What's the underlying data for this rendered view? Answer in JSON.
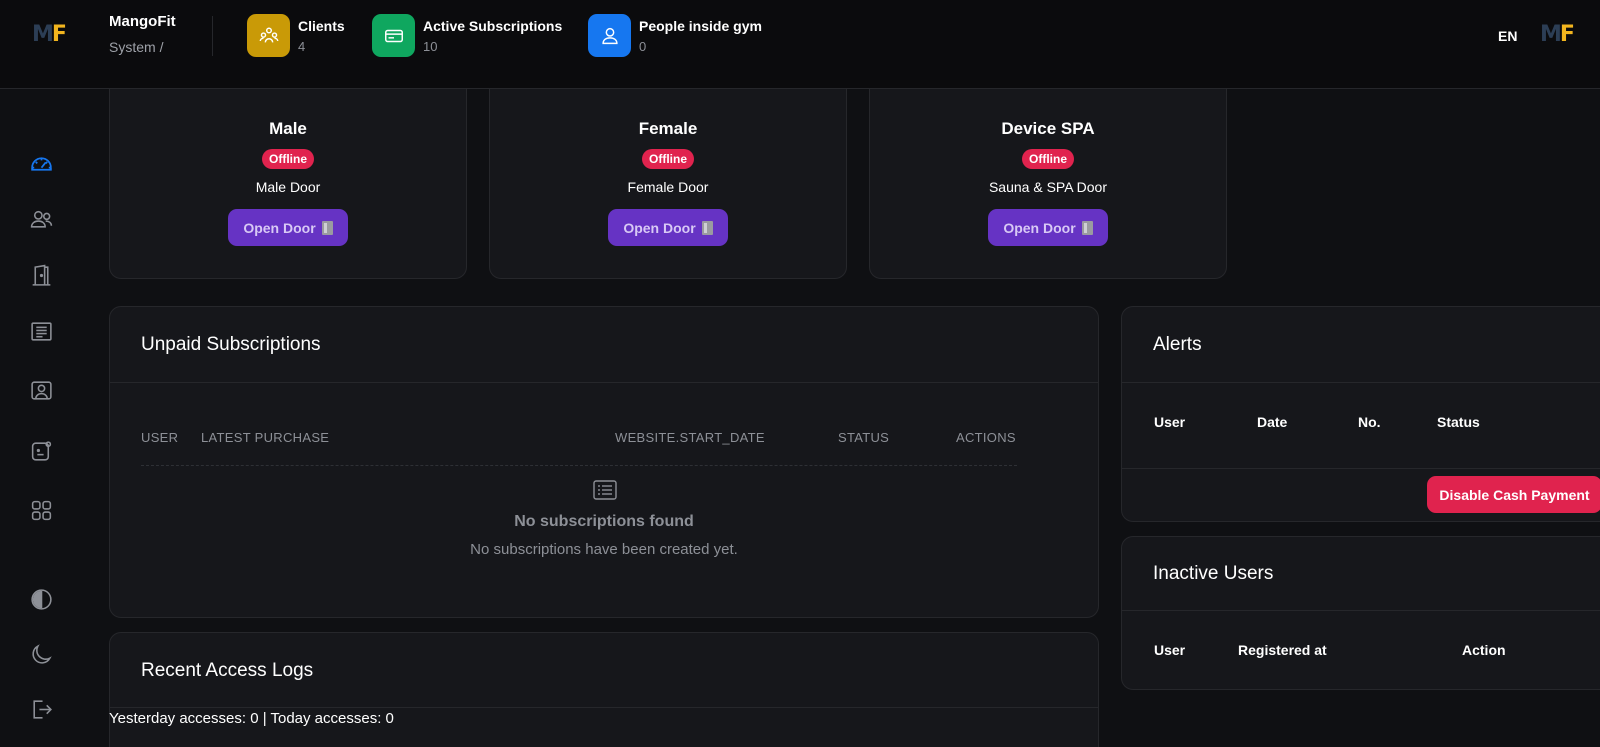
{
  "header": {
    "logo_text": "MF",
    "brand": "MangoFit",
    "breadcrumb": "System  /",
    "stats": [
      {
        "label": "Clients",
        "value": "4",
        "icon": "clients-icon",
        "color": "#c99a07"
      },
      {
        "label": "Active Subscriptions",
        "value": "10",
        "icon": "card-icon",
        "color": "#0fa75f"
      },
      {
        "label": "People inside gym",
        "value": "0",
        "icon": "user-icon",
        "color": "#1677f0"
      }
    ],
    "language": "EN"
  },
  "sidebar": {
    "items": [
      {
        "icon": "dashboard-icon",
        "active": true
      },
      {
        "icon": "users-icon"
      },
      {
        "icon": "door-icon"
      },
      {
        "icon": "receipt-icon"
      },
      {
        "icon": "contact-card-icon"
      },
      {
        "icon": "app-icon"
      },
      {
        "icon": "grid-icon"
      },
      {
        "icon": "contrast-icon"
      },
      {
        "icon": "moon-icon"
      },
      {
        "icon": "logout-icon"
      }
    ]
  },
  "doors": [
    {
      "name": "Male",
      "status": "Offline",
      "desc": "Male Door",
      "button": "Open Door"
    },
    {
      "name": "Female",
      "status": "Offline",
      "desc": "Female Door",
      "button": "Open Door"
    },
    {
      "name": "Device SPA",
      "status": "Offline",
      "desc": "Sauna & SPA Door",
      "button": "Open Door"
    }
  ],
  "unpaid": {
    "title": "Unpaid Subscriptions",
    "columns": [
      "USER",
      "LATEST PURCHASE",
      "WEBSITE.START_DATE",
      "STATUS",
      "ACTIONS"
    ],
    "empty_title": "No subscriptions found",
    "empty_sub": "No subscriptions have been created yet."
  },
  "alerts": {
    "title": "Alerts",
    "columns": [
      "User",
      "Date",
      "No.",
      "Status"
    ],
    "button": "Disable Cash Payment"
  },
  "inactive": {
    "title": "Inactive Users",
    "columns": [
      "User",
      "Registered at",
      "Action"
    ]
  },
  "logs": {
    "title": "Recent Access Logs",
    "summary": "Yesterday accesses: 0 | Today accesses: 0"
  },
  "colors": {
    "accent_blue": "#1677f0",
    "danger": "#e0234e",
    "purple": "#6633c4"
  }
}
